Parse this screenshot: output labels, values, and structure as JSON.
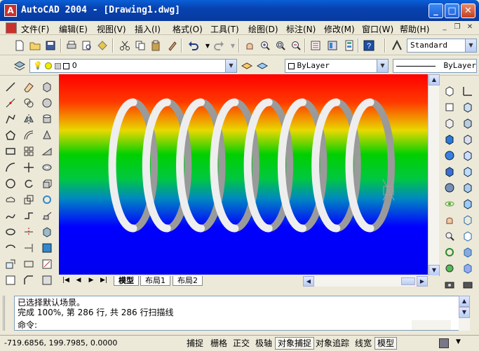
{
  "window": {
    "title": "AutoCAD 2004 - [Drawing1.dwg]",
    "controls": {
      "minimize": "_",
      "maximize": "□",
      "close": "✕"
    }
  },
  "menu": {
    "items": [
      "文件(F)",
      "编辑(E)",
      "视图(V)",
      "插入(I)",
      "格式(O)",
      "工具(T)",
      "绘图(D)",
      "标注(N)",
      "修改(M)",
      "窗口(W)",
      "帮助(H)"
    ],
    "doc_controls": {
      "minimize": "_",
      "restore": "❐",
      "close": "✕"
    }
  },
  "standard_toolbar": {
    "text_style": "Standard"
  },
  "layers_toolbar": {
    "current_layer": "0",
    "color": "ByLayer",
    "linetype": "ByLayer"
  },
  "tabs": [
    "模型",
    "布局1",
    "布局2"
  ],
  "command": {
    "history": [
      "已选择默认场景。",
      "完成 100%, 第 286 行, 共 286 行扫描线"
    ],
    "prompt": "命令:"
  },
  "status": {
    "coordinates": "-719.6856, 199.7985, 0.0000",
    "toggles": [
      "捕捉",
      "栅格",
      "正交",
      "极轴",
      "对象捕捉",
      "对象追踪",
      "线宽",
      "模型"
    ]
  },
  "colors": {
    "titlebar": "#0842b0",
    "viewport_top": "#ff0000",
    "viewport_mid": "#00d000",
    "viewport_bottom": "#0000ff",
    "spring": "#e4e4e4"
  }
}
